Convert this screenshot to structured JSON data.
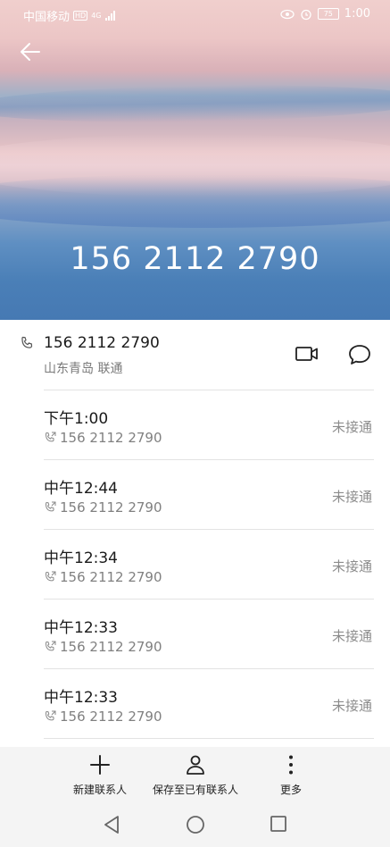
{
  "status_bar": {
    "carrier": "中国移动",
    "hd": "HD",
    "network": "4G",
    "battery": "75",
    "time": "1:00"
  },
  "header": {
    "back_icon": "arrow-left-icon",
    "number": "156 2112 2790"
  },
  "contact": {
    "number": "156 2112 2790",
    "location": "山东青岛 联通"
  },
  "calls": [
    {
      "time": "下午1:00",
      "number": "156 2112 2790",
      "status": "未接通"
    },
    {
      "time": "中午12:44",
      "number": "156 2112 2790",
      "status": "未接通"
    },
    {
      "time": "中午12:34",
      "number": "156 2112 2790",
      "status": "未接通"
    },
    {
      "time": "中午12:33",
      "number": "156 2112 2790",
      "status": "未接通"
    },
    {
      "time": "中午12:33",
      "number": "156 2112 2790",
      "status": "未接通"
    }
  ],
  "actions": {
    "new_contact": "新建联系人",
    "save_existing": "保存至已有联系人",
    "more": "更多"
  },
  "colors": {
    "hero_bottom": "#4679b3",
    "hero_top": "#f0cfcd",
    "secondary_text": "#808080"
  }
}
